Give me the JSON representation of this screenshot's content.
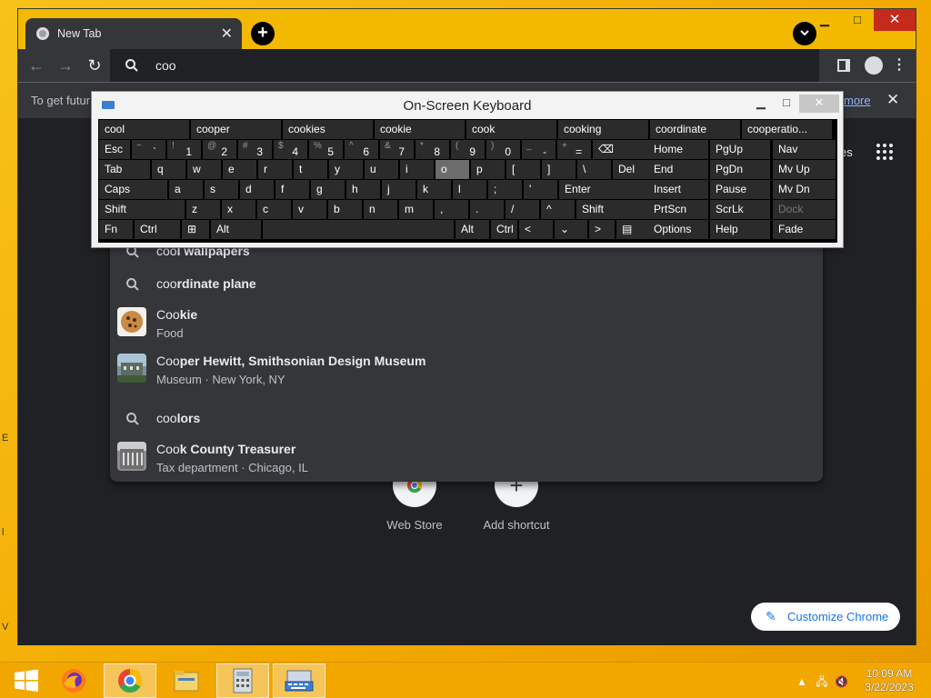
{
  "browser": {
    "tab_title": "New Tab",
    "omnibox_text": "coo",
    "infobar_text": "To get futur",
    "infobar_link": "more",
    "apps_text": "es"
  },
  "shortcuts": [
    {
      "label": "Web Store"
    },
    {
      "label": "Add shortcut"
    }
  ],
  "customize_label": "Customize Chrome",
  "suggestions": [
    {
      "type": "search",
      "prefix": "coo",
      "rest": "l wallpapers"
    },
    {
      "type": "search",
      "prefix": "coo",
      "rest": "rdinate plane"
    },
    {
      "type": "entity",
      "thumb": "cookie",
      "prefix": "Coo",
      "rest": "kie",
      "sub": "Food"
    },
    {
      "type": "entity",
      "thumb": "museum",
      "prefix": "Coo",
      "rest": "per Hewitt, Smithsonian Design Museum",
      "sub": "Museum · New York, NY"
    },
    {
      "type": "search",
      "prefix": "coo",
      "rest": "lors"
    },
    {
      "type": "entity",
      "thumb": "building",
      "prefix": "Coo",
      "rest": "k County Treasurer",
      "sub": "Tax department · Chicago, IL"
    }
  ],
  "osk": {
    "title": "On-Screen Keyboard",
    "predictions": [
      "cool",
      "cooper",
      "cookies",
      "cookie",
      "cook",
      "cooking",
      "coordinate",
      "cooperatio..."
    ],
    "row1": [
      {
        "label": "Esc"
      },
      {
        "shift": "~",
        "main": "`"
      },
      {
        "shift": "!",
        "main": "1"
      },
      {
        "shift": "@",
        "main": "2"
      },
      {
        "shift": "#",
        "main": "3"
      },
      {
        "shift": "$",
        "main": "4"
      },
      {
        "shift": "%",
        "main": "5"
      },
      {
        "shift": "^",
        "main": "6"
      },
      {
        "shift": "&",
        "main": "7"
      },
      {
        "shift": "*",
        "main": "8"
      },
      {
        "shift": "(",
        "main": "9"
      },
      {
        "shift": ")",
        "main": "0"
      },
      {
        "shift": "_",
        "main": "-"
      },
      {
        "shift": "+",
        "main": "="
      },
      {
        "label": "⌫"
      }
    ],
    "row2": [
      "Tab",
      "q",
      "w",
      "e",
      "r",
      "t",
      "y",
      "u",
      "i",
      "o",
      "p",
      "[",
      "]",
      "\\",
      "Del"
    ],
    "row2_shift": {
      "[": "{",
      "]": "}",
      "\\": "|"
    },
    "row3": [
      "Caps",
      "a",
      "s",
      "d",
      "f",
      "g",
      "h",
      "j",
      "k",
      "l",
      ";",
      "'",
      "Enter"
    ],
    "row3_shift": {
      ";": ":",
      "'": "\""
    },
    "row4": [
      "Shift",
      "z",
      "x",
      "c",
      "v",
      "b",
      "n",
      "m",
      ",",
      ".",
      "/",
      "^",
      "Shift"
    ],
    "row4_shift": {
      ",": "<",
      ".": ">",
      "/": "?"
    },
    "row5": [
      "Fn",
      "Ctrl",
      "⊞",
      "Alt",
      "",
      "Alt",
      "Ctrl",
      "<",
      "⌄",
      ">",
      "▤"
    ],
    "nav_col1": [
      "Home",
      "End",
      "Insert",
      "PrtScn",
      "Options"
    ],
    "nav_col2": [
      "PgUp",
      "PgDn",
      "Pause",
      "ScrLk",
      "Help"
    ],
    "nav_col3": [
      "Nav",
      "Mv Up",
      "Mv Dn",
      "Dock",
      "Fade"
    ]
  },
  "clock": {
    "time": "10:09 AM",
    "date": "3/22/2023"
  },
  "taskbar_items": [
    "start-button",
    "firefox",
    "chrome",
    "file-explorer",
    "calculator",
    "on-screen-keyboard"
  ]
}
